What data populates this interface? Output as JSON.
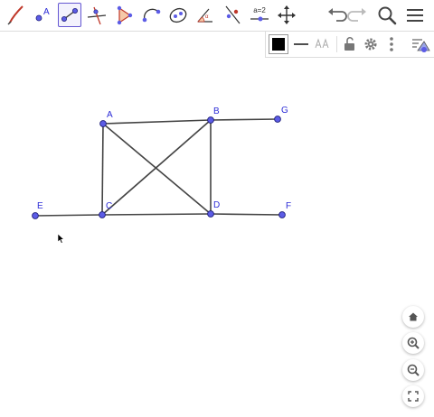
{
  "toolbar": {
    "tools": [
      {
        "name": "pen-tool",
        "selected": false
      },
      {
        "name": "point-tool",
        "selected": false
      },
      {
        "name": "segment-tool",
        "selected": true
      },
      {
        "name": "perpendicular-line-tool",
        "selected": false
      },
      {
        "name": "polygon-tool",
        "selected": false
      },
      {
        "name": "circular-arc-tool",
        "selected": false
      },
      {
        "name": "conic-tool",
        "selected": false
      },
      {
        "name": "angle-tool",
        "selected": false
      },
      {
        "name": "reflect-tool",
        "selected": false
      },
      {
        "name": "slider-tool",
        "selected": false,
        "text": "a=2"
      },
      {
        "name": "move-graphics-view-tool",
        "selected": false
      }
    ],
    "actions": [
      "undo-icon",
      "redo-icon",
      "search-icon",
      "menu-icon"
    ]
  },
  "stylebar": {
    "color": "#000000",
    "items": [
      "color-swatch",
      "line-style-icon",
      "label-style-icon",
      "lock-icon",
      "gear-icon",
      "more-options-icon",
      "algebra-view-toggle-icon"
    ]
  },
  "colors": {
    "accent": "#6557d2",
    "point_fill": "#5c5ce6",
    "point_stroke": "#1f1f7a",
    "segment": "#444444",
    "label": "#2b2bd6"
  },
  "points": [
    {
      "label": "A"
    },
    {
      "label": "B"
    },
    {
      "label": "G"
    },
    {
      "label": "C"
    },
    {
      "label": "D"
    },
    {
      "label": "E"
    },
    {
      "label": "F"
    }
  ],
  "zoom_controls": [
    "home-icon",
    "zoom-in-icon",
    "zoom-out-icon",
    "fullscreen-icon"
  ]
}
